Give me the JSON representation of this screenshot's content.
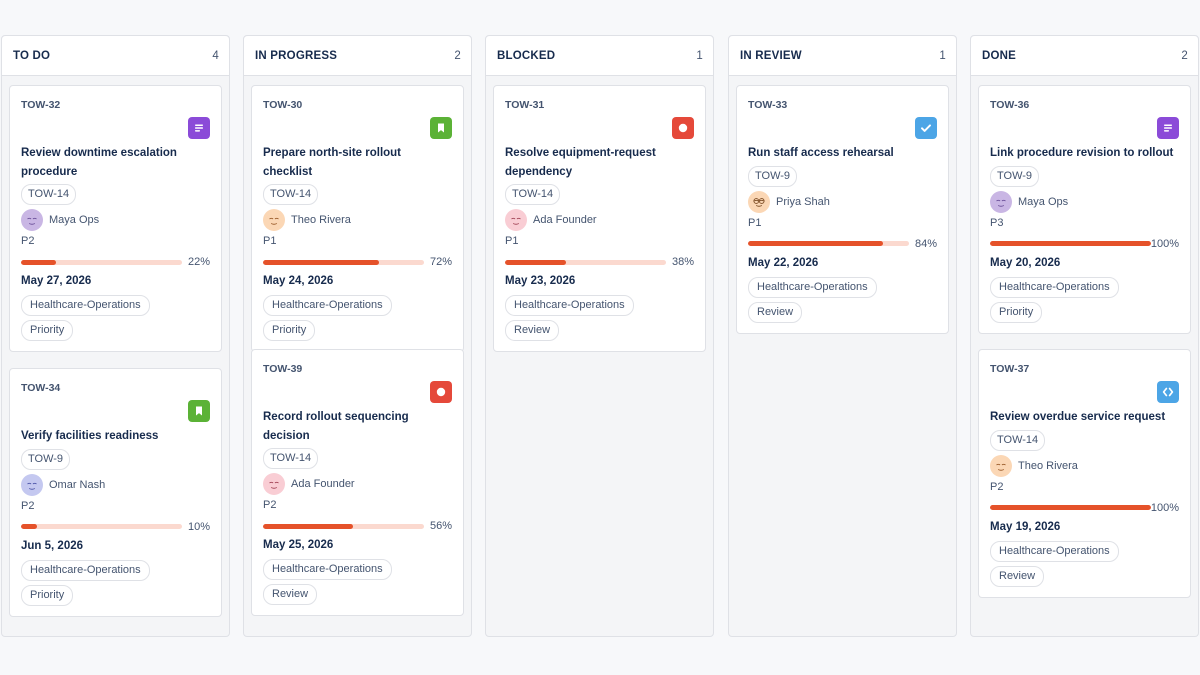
{
  "colors": {
    "accent_progress": "#e5522a",
    "progress_track": "#fbd9cf",
    "icon_task": "#8b4bd8",
    "icon_story": "#5bb236",
    "icon_bug": "#e5493a",
    "icon_check": "#4ca5e6",
    "icon_code": "#4ca5e6"
  },
  "columns": [
    {
      "title": "TO DO",
      "count": "4",
      "cards": [
        {
          "key": "TOW-32",
          "type_icon": "task-icon",
          "title": "Review downtime escalation procedure",
          "parent": "TOW-14",
          "assignee": "Maya Ops",
          "avatar_icon": "avatar-purple",
          "priority": "P2",
          "progress_pct": "22%",
          "progress": 0.22,
          "due": "May 27, 2026",
          "labels": [
            "Healthcare-Operations",
            "Priority"
          ]
        },
        {
          "key": "TOW-34",
          "type_icon": "story-icon",
          "title": "Verify facilities readiness",
          "parent": "TOW-9",
          "assignee": "Omar Nash",
          "avatar_icon": "avatar-blue",
          "priority": "P2",
          "progress_pct": "10%",
          "progress": 0.1,
          "due": "Jun 5, 2026",
          "labels": [
            "Healthcare-Operations",
            "Priority"
          ]
        }
      ]
    },
    {
      "title": "IN PROGRESS",
      "count": "2",
      "cards": [
        {
          "key": "TOW-30",
          "type_icon": "story-icon",
          "title": "Prepare north-site rollout checklist",
          "parent": "TOW-14",
          "assignee": "Theo Rivera",
          "avatar_icon": "avatar-peach",
          "priority": "P1",
          "progress_pct": "72%",
          "progress": 0.72,
          "due": "May 24, 2026",
          "labels": [
            "Healthcare-Operations",
            "Priority"
          ]
        },
        {
          "key": "TOW-39",
          "type_icon": "bug-icon",
          "title": "Record rollout sequencing decision",
          "parent": "TOW-14",
          "assignee": "Ada Founder",
          "avatar_icon": "avatar-pink",
          "priority": "P2",
          "progress_pct": "56%",
          "progress": 0.56,
          "due": "May 25, 2026",
          "labels": [
            "Healthcare-Operations",
            "Review"
          ]
        }
      ]
    },
    {
      "title": "BLOCKED",
      "count": "1",
      "cards": [
        {
          "key": "TOW-31",
          "type_icon": "bug-icon",
          "title": "Resolve equipment-request dependency",
          "parent": "TOW-14",
          "assignee": "Ada Founder",
          "avatar_icon": "avatar-pink",
          "priority": "P1",
          "progress_pct": "38%",
          "progress": 0.38,
          "due": "May 23, 2026",
          "labels": [
            "Healthcare-Operations",
            "Review"
          ]
        }
      ]
    },
    {
      "title": "IN REVIEW",
      "count": "1",
      "cards": [
        {
          "key": "TOW-33",
          "type_icon": "check-icon",
          "title": "Run staff access rehearsal",
          "parent": "TOW-9",
          "assignee": "Priya Shah",
          "avatar_icon": "avatar-peach-glasses",
          "priority": "P1",
          "progress_pct": "84%",
          "progress": 0.84,
          "due": "May 22, 2026",
          "labels": [
            "Healthcare-Operations",
            "Review"
          ]
        }
      ]
    },
    {
      "title": "DONE",
      "count": "2",
      "cards": [
        {
          "key": "TOW-36",
          "type_icon": "task-icon",
          "title": "Link procedure revision to rollout",
          "parent": "TOW-9",
          "assignee": "Maya Ops",
          "avatar_icon": "avatar-purple",
          "priority": "P3",
          "progress_pct": "100%",
          "progress": 1.0,
          "due": "May 20, 2026",
          "labels": [
            "Healthcare-Operations",
            "Priority"
          ]
        },
        {
          "key": "TOW-37",
          "type_icon": "code-icon",
          "title": "Review overdue service request",
          "parent": "TOW-14",
          "assignee": "Theo Rivera",
          "avatar_icon": "avatar-peach",
          "priority": "P2",
          "progress_pct": "100%",
          "progress": 1.0,
          "due": "May 19, 2026",
          "labels": [
            "Healthcare-Operations",
            "Review"
          ]
        }
      ]
    }
  ]
}
